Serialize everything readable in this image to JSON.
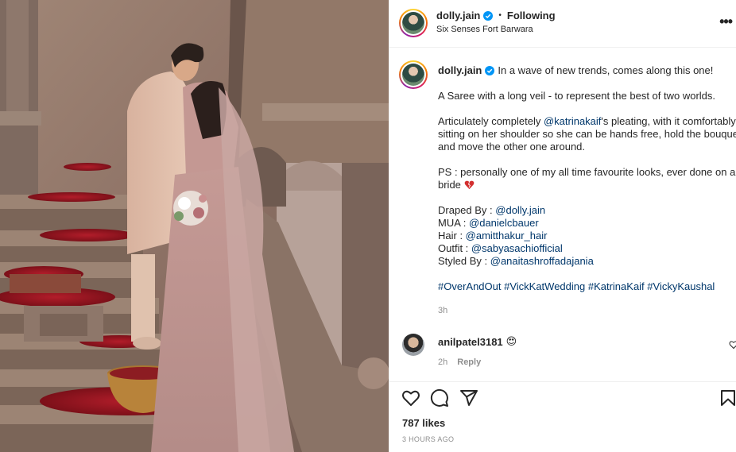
{
  "post": {
    "username": "dolly.jain",
    "verified": true,
    "follow_status": "Following",
    "separator": "•",
    "location": "Six Senses Fort Barwara",
    "more_menu": "•••"
  },
  "caption": {
    "username": "dolly.jain",
    "intro": "In a wave of new trends, comes along this one!",
    "para2": "A Saree with a long veil - to represent the best of two worlds.",
    "para3_pre": "Articulately completely ",
    "para3_mention": "@katrinakaif",
    "para3_line1_rest": "'s pleating, with it comfortably",
    "para3_line2": "sitting on her shoulder so she can be hands free, hold the bouquet",
    "para3_line3": "and move the other one around.",
    "ps_line1": "PS : personally one of my all time favourite looks, ever done on any",
    "ps_line2": "bride",
    "credits": [
      {
        "label": "Draped By : ",
        "handle": "@dolly.jain"
      },
      {
        "label": "MUA : ",
        "handle": "@danielcbauer"
      },
      {
        "label": "Hair : ",
        "handle": "@amitthakur_hair"
      },
      {
        "label": "Outfit : ",
        "handle": "@sabyasachiofficial"
      },
      {
        "label": "Styled By : ",
        "handle": "@anaitashroffadajania"
      }
    ],
    "hashtags": "#OverAndOut #VickKatWedding #KatrinaKaif #VickyKaushal",
    "time": "3h"
  },
  "comment": {
    "username": "anilpatel3181",
    "emoji": "😍",
    "time": "2h",
    "reply_label": "Reply"
  },
  "actions": {
    "likes": "787 likes",
    "posted_ago": "3 HOURS AGO"
  },
  "icons": {
    "like": "heart-icon",
    "comment": "comment-icon",
    "share": "share-icon",
    "save": "bookmark-icon",
    "verified": "verified-badge-icon",
    "more": "more-options-icon"
  },
  "colors": {
    "text": "#262626",
    "secondary": "#8e8e8e",
    "mention": "#00376b",
    "verified": "#0095f6",
    "border": "#efefef"
  }
}
